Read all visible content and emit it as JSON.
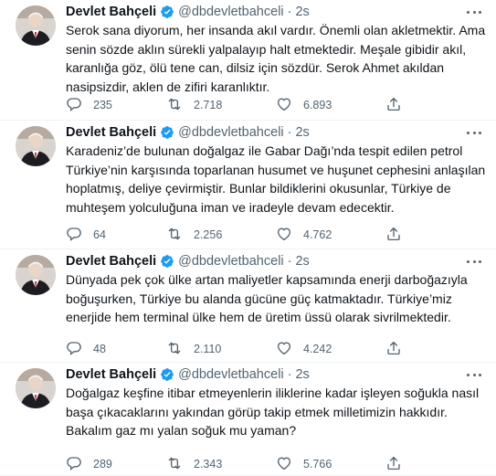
{
  "tweets": [
    {
      "name": "Devlet Bahçeli",
      "handle": "@dbdevletbahceli",
      "separator": "·",
      "time": "2s",
      "text": "Serok sana diyorum, her insanda akıl vardır. Önemli olan akletmektir. Ama senin sözde aklın sürekli yalpalayıp halt etmektedir. Meşale gibidir akıl, karanlığa göz, ölü tene can, dilsiz için sözdür. Serok Ahmet akıldan nasipsizdir, aklen de zifiri karanlıktır.",
      "replies": "235",
      "retweets": "2.718",
      "likes": "6.893"
    },
    {
      "name": "Devlet Bahçeli",
      "handle": "@dbdevletbahceli",
      "separator": "·",
      "time": "2s",
      "text": "Karadeniz’de bulunan doğalgaz ile Gabar Dağı’nda tespit edilen petrol Türkiye’nin karşısında toparlanan husumet ve huşunet cephesini anlaşılan hoplatmış, deliye çevirmiştir. Bunlar bildiklerini okusunlar, Türkiye de muhteşem yolculuğuna iman ve iradeyle devam edecektir.",
      "replies": "64",
      "retweets": "2.256",
      "likes": "4.762"
    },
    {
      "name": "Devlet Bahçeli",
      "handle": "@dbdevletbahceli",
      "separator": "·",
      "time": "2s",
      "text": "Dünyada pek çok ülke artan maliyetler kapsamında enerji darboğazıyla boğuşurken, Türkiye bu alanda gücüne güç katmaktadır. Türkiye’miz enerjide hem terminal ülke hem de üretim üssü olarak sivrilmektedir.",
      "replies": "48",
      "retweets": "2.110",
      "likes": "4.242"
    },
    {
      "name": "Devlet Bahçeli",
      "handle": "@dbdevletbahceli",
      "separator": "·",
      "time": "2s",
      "text": "Doğalgaz keşfine itibar etmeyenlerin iliklerine kadar işleyen soğukla nasıl başa çıkacaklarını yakından görüp takip etmek milletimizin hakkıdır. Bakalım gaz mı yalan soğuk mu yaman?",
      "replies": "289",
      "retweets": "2.343",
      "likes": "5.766"
    }
  ],
  "icons": {
    "verified": "verified-badge-icon",
    "reply": "reply-icon",
    "retweet": "retweet-icon",
    "like": "heart-icon",
    "share": "share-icon",
    "more": "more-icon"
  },
  "colors": {
    "verified": "#1d9bf0",
    "secondary_text": "#536471",
    "primary_text": "#0f1419",
    "divider": "#eff3f4"
  }
}
